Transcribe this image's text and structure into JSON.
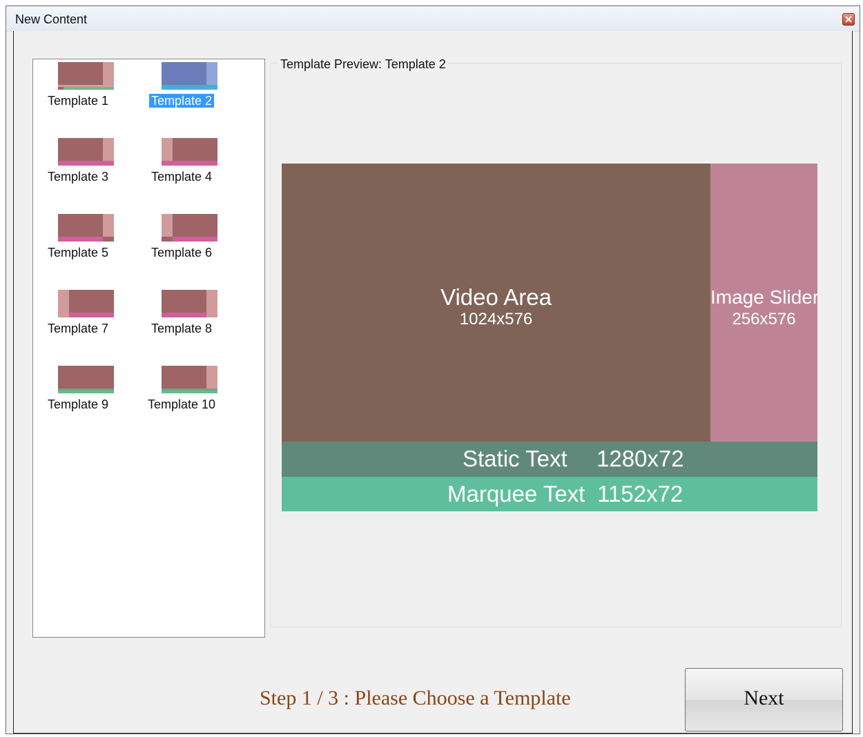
{
  "window": {
    "title": "New Content"
  },
  "templates": [
    {
      "label": "Template 1"
    },
    {
      "label": "Template 2",
      "selected": true
    },
    {
      "label": "Template 3"
    },
    {
      "label": "Template 4"
    },
    {
      "label": "Template 5"
    },
    {
      "label": "Template 6"
    },
    {
      "label": "Template 7"
    },
    {
      "label": "Template 8"
    },
    {
      "label": "Template 9"
    },
    {
      "label": "Template 10"
    }
  ],
  "preview": {
    "legend": "Template Preview: Template 2",
    "video": {
      "name": "Video Area",
      "size": "1024x576"
    },
    "image": {
      "name": "Image Slider",
      "size": "256x576"
    },
    "static": {
      "name": "Static Text",
      "size": "1280x72"
    },
    "marquee": {
      "name": "Marquee Text",
      "size": "1152x72"
    }
  },
  "colors": {
    "video": "#7f6357",
    "image": "#be8495",
    "static": "#60897b",
    "marquee": "#5fbf9d",
    "selection": "#3399ff",
    "step_text": "#8b4513"
  },
  "footer": {
    "step": "Step 1 / 3 : Please Choose a Template",
    "next": "Next"
  }
}
